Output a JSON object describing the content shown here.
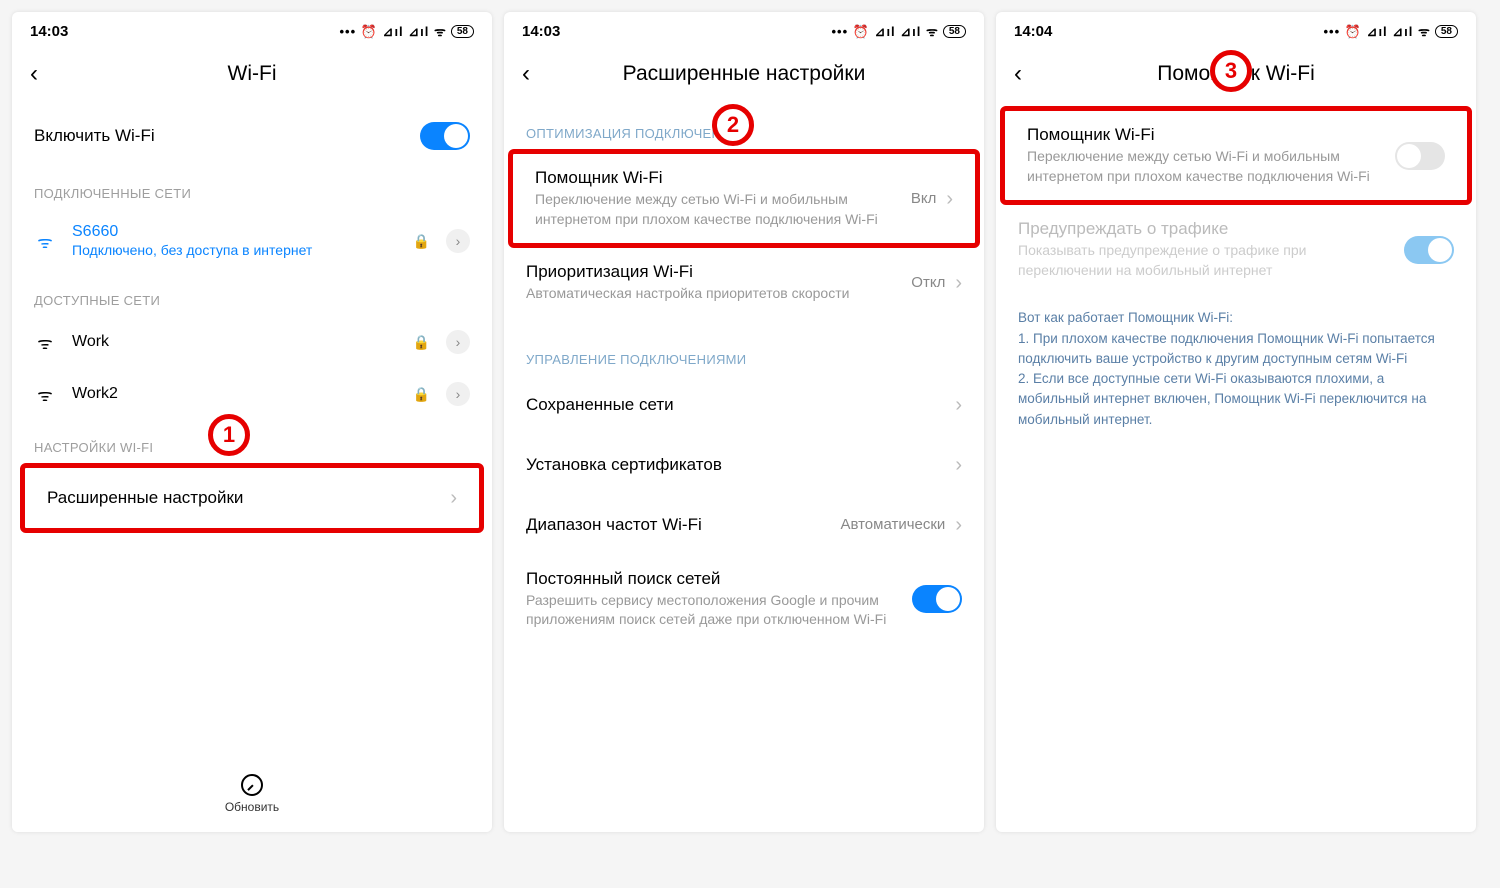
{
  "screens": {
    "s1": {
      "time": "14:03",
      "battery": "58",
      "title": "Wi-Fi",
      "toggle_label": "Включить Wi-Fi",
      "section_connected": "ПОДКЛЮЧЕННЫЕ СЕТИ",
      "network_name": "S6660",
      "network_status": "Подключено, без доступа в интернет",
      "section_available": "ДОСТУПНЫЕ СЕТИ",
      "net1": "Work",
      "net2": "Work2",
      "section_settings": "НАСТРОЙКИ WI-FI",
      "advanced": "Расширенные настройки",
      "refresh": "Обновить",
      "badge": "1"
    },
    "s2": {
      "time": "14:03",
      "battery": "58",
      "title": "Расширенные настройки",
      "section_opt": "ОПТИМИЗАЦИЯ ПОДКЛЮЧЕНИЯ",
      "assistant_title": "Помощник Wi-Fi",
      "assistant_desc": "Переключение между сетью Wi-Fi и мобильным интернетом при плохом качестве подключения Wi-Fi",
      "assistant_value": "Вкл",
      "priority_title": "Приоритизация Wi-Fi",
      "priority_desc": "Автоматическая настройка приоритетов скорости",
      "priority_value": "Откл",
      "section_mgmt": "УПРАВЛЕНИЕ ПОДКЛЮЧЕНИЯМИ",
      "saved": "Сохраненные сети",
      "certs": "Установка сертификатов",
      "band_title": "Диапазон частот Wi-Fi",
      "band_value": "Автоматически",
      "scan_title": "Постоянный поиск сетей",
      "scan_desc": "Разрешить сервису местоположения Google и прочим приложениям поиск сетей даже при отключенном Wi-Fi",
      "badge": "2"
    },
    "s3": {
      "time": "14:04",
      "battery": "58",
      "title": "Помощник Wi-Fi",
      "assistant_title": "Помощник Wi-Fi",
      "assistant_desc": "Переключение между сетью Wi-Fi и мобильным интернетом при плохом качестве подключения Wi-Fi",
      "traffic_title": "Предупреждать о трафике",
      "traffic_desc": "Показывать предупреждение о трафике при переключении на мобильный интернет",
      "help": "Вот как работает Помощник Wi-Fi:\n1. При плохом качестве подключения Помощник Wi-Fi попытается подключить ваше устройство к другим доступным сетям Wi-Fi\n2. Если все доступные сети Wi-Fi оказываются плохими, а мобильный интернет включен, Помощник Wi-Fi переключится на мобильный интернет.",
      "badge": "3"
    }
  }
}
